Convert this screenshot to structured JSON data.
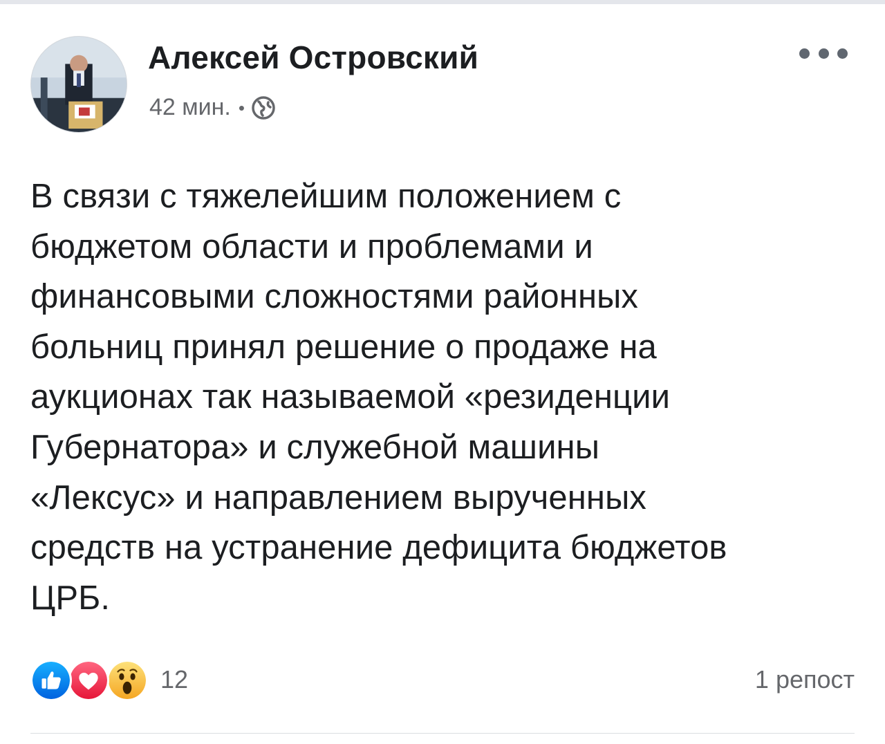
{
  "post": {
    "author": {
      "name": "Алексей Островский",
      "avatar_icon": "avatar-photo"
    },
    "timestamp": "42 мин.",
    "separator": "•",
    "privacy_icon": "globe-icon",
    "more_icon": "more-options-icon",
    "text_lines": [
      "В связи с тяжелейшим положением с",
      "бюджетом области и проблемами и",
      "финансовыми сложностями районных",
      "больниц принял решение о продаже на",
      "аукционах так называемой «резиденции",
      "Губернатора» и служебной машины",
      "«Лексус» и направлением вырученных",
      "средств на устранение дефицита бюджетов",
      "ЦРБ."
    ],
    "reactions": {
      "icons": [
        "like-icon",
        "love-icon",
        "wow-icon"
      ],
      "count": "12"
    },
    "shares": "1 репост"
  },
  "colors": {
    "text_primary": "#1c1e21",
    "text_secondary": "#65676b",
    "like_blue": "#1877f2",
    "love_red": "#f33e58",
    "wow_yellow": "#f7b125"
  }
}
